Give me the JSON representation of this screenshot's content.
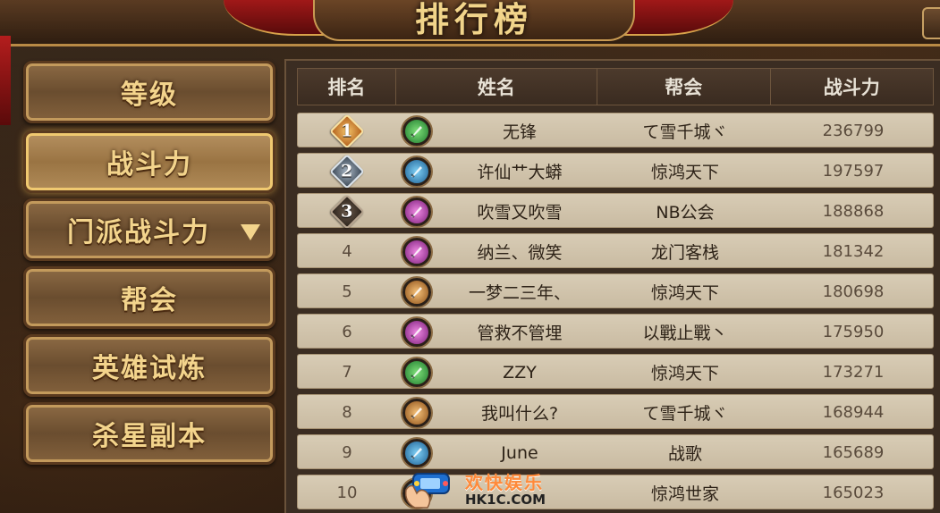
{
  "title": "排行榜",
  "menu": {
    "items": [
      {
        "label": "等级"
      },
      {
        "label": "战斗力"
      },
      {
        "label": "门派战斗力"
      },
      {
        "label": "帮会"
      },
      {
        "label": "英雄试炼"
      },
      {
        "label": "杀星副本"
      }
    ],
    "active_index": 1
  },
  "table": {
    "headers": {
      "rank": "排名",
      "name": "姓名",
      "guild": "帮会",
      "power": "战斗力"
    },
    "rows": [
      {
        "rank": "1",
        "medal": "gold",
        "role": "green",
        "name": "无锋",
        "guild": "て雪千城ヾ",
        "power": "236799"
      },
      {
        "rank": "2",
        "medal": "silver",
        "role": "blue",
        "name": "许仙艹大蟒",
        "guild": "惊鸿天下",
        "power": "197597"
      },
      {
        "rank": "3",
        "medal": "bronze",
        "role": "purple",
        "name": "吹雪又吹雪",
        "guild": "NB公会",
        "power": "188868"
      },
      {
        "rank": "4",
        "medal": "",
        "role": "purple",
        "name": "纳兰、微笑",
        "guild": "龙门客栈",
        "power": "181342"
      },
      {
        "rank": "5",
        "medal": "",
        "role": "orange",
        "name": "一梦二三年、",
        "guild": "惊鸿天下",
        "power": "180698"
      },
      {
        "rank": "6",
        "medal": "",
        "role": "purple",
        "name": "管救不管埋",
        "guild": "以戰止戰丶",
        "power": "175950"
      },
      {
        "rank": "7",
        "medal": "",
        "role": "green",
        "name": "ZZY",
        "guild": "惊鸿天下",
        "power": "173271"
      },
      {
        "rank": "8",
        "medal": "",
        "role": "orange",
        "name": "我叫什么?",
        "guild": "て雪千城ヾ",
        "power": "168944"
      },
      {
        "rank": "9",
        "medal": "",
        "role": "blue",
        "name": "June",
        "guild": "战歌",
        "power": "165689"
      },
      {
        "rank": "10",
        "medal": "",
        "role": "blue",
        "name": "",
        "guild": "惊鸿世家",
        "power": "165023"
      }
    ]
  },
  "watermark": {
    "cn": "欢快娱乐",
    "en": "HK1C.COM"
  },
  "colors": {
    "title_gold": "#f1d48a",
    "row_bg": "#d8ccb5",
    "panel_bg": "#3b2d22",
    "curtain_red": "#a01818"
  },
  "icons": {
    "role_green": "jade-weapon-icon",
    "role_blue": "gear-weapon-icon",
    "role_purple": "crystal-weapon-icon",
    "role_orange": "blade-weapon-icon"
  }
}
